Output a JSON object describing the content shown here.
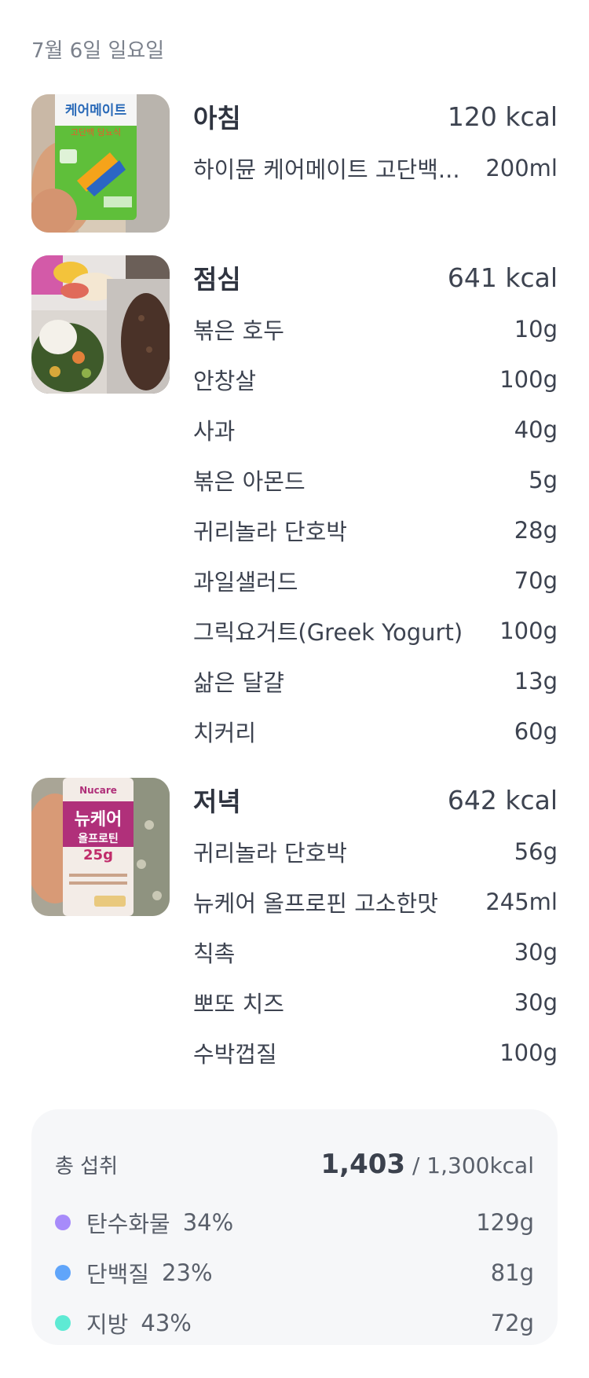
{
  "date": "7월 6일 일요일",
  "meals": [
    {
      "name": "아침",
      "kcal": "120 kcal",
      "photo_icon": "drink-carton-photo",
      "photo_labels": [
        "케어메이트",
        "고단백 당뇨식"
      ],
      "foods": [
        {
          "name": "하이뮨 케어메이트 고단백...",
          "amount": "200ml"
        }
      ]
    },
    {
      "name": "점심",
      "kcal": "641 kcal",
      "photo_icon": "lunch-container-photo",
      "foods": [
        {
          "name": "볶은 호두",
          "amount": "10g"
        },
        {
          "name": "안창살",
          "amount": "100g"
        },
        {
          "name": "사과",
          "amount": "40g"
        },
        {
          "name": "볶은 아몬드",
          "amount": "5g"
        },
        {
          "name": "귀리놀라 단호박",
          "amount": "28g"
        },
        {
          "name": "과일샐러드",
          "amount": "70g"
        },
        {
          "name": "그릭요거트(Greek Yogurt)",
          "amount": "100g"
        },
        {
          "name": "삶은 달걀",
          "amount": "13g"
        },
        {
          "name": "치커리",
          "amount": "60g"
        }
      ]
    },
    {
      "name": "저녁",
      "kcal": "642 kcal",
      "photo_icon": "protein-drink-photo",
      "photo_labels": [
        "Nucare",
        "뉴케어",
        "올프로틴",
        "25g"
      ],
      "foods": [
        {
          "name": "귀리놀라 단호박",
          "amount": "56g"
        },
        {
          "name": "뉴케어 올프로핀 고소한맛",
          "amount": "245ml"
        },
        {
          "name": "칙촉",
          "amount": "30g"
        },
        {
          "name": "뽀또 치즈",
          "amount": "30g"
        },
        {
          "name": "수박껍질",
          "amount": "100g"
        }
      ]
    }
  ],
  "summary": {
    "title": "총 섭취",
    "total": "1,403",
    "goal": "/ 1,300kcal",
    "macros": [
      {
        "name": "탄수화물",
        "percent": "34%",
        "amount": "129g",
        "color": "#a78bfa"
      },
      {
        "name": "단백질",
        "percent": "23%",
        "amount": "81g",
        "color": "#60a5fa"
      },
      {
        "name": "지방",
        "percent": "43%",
        "amount": "72g",
        "color": "#5eead4"
      }
    ]
  }
}
